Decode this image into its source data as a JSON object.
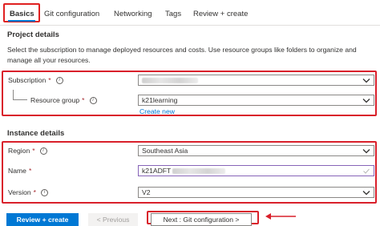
{
  "tabs": [
    {
      "label": "Basics",
      "active": true
    },
    {
      "label": "Git configuration"
    },
    {
      "label": "Networking"
    },
    {
      "label": "Tags"
    },
    {
      "label": "Review + create"
    }
  ],
  "project": {
    "heading": "Project details",
    "description": "Select the subscription to manage deployed resources and costs. Use resource groups like folders to organize and manage all your resources.",
    "subscription": {
      "label": "Subscription",
      "required": "*",
      "value_obscured": true
    },
    "resource_group": {
      "label": "Resource group",
      "required": "*",
      "value": "k21learning",
      "create_new": "Create new"
    }
  },
  "instance": {
    "heading": "Instance details",
    "region": {
      "label": "Region",
      "required": "*",
      "value": "Southeast Asia"
    },
    "name": {
      "label": "Name",
      "required": "*",
      "value": "k21ADFT"
    },
    "version": {
      "label": "Version",
      "required": "*",
      "value": "V2"
    }
  },
  "footer": {
    "review_create": "Review + create",
    "previous": "< Previous",
    "next": "Next : Git configuration >"
  },
  "colors": {
    "accent": "#0078d4",
    "highlight": "#d9202b",
    "required": "#a4262c"
  }
}
